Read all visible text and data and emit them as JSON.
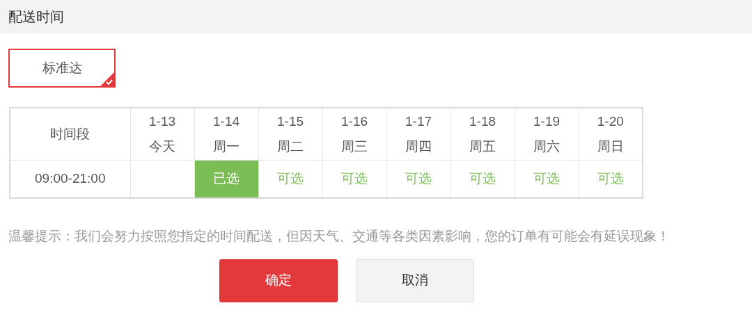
{
  "header": {
    "title": "配送时间"
  },
  "delivery_options": [
    {
      "label": "标准达",
      "selected": true
    }
  ],
  "schedule": {
    "corner_label": "时间段",
    "days": [
      {
        "date": "1-13",
        "weekday": "今天"
      },
      {
        "date": "1-14",
        "weekday": "周一"
      },
      {
        "date": "1-15",
        "weekday": "周二"
      },
      {
        "date": "1-16",
        "weekday": "周三"
      },
      {
        "date": "1-17",
        "weekday": "周四"
      },
      {
        "date": "1-18",
        "weekday": "周五"
      },
      {
        "date": "1-19",
        "weekday": "周六"
      },
      {
        "date": "1-20",
        "weekday": "周日"
      }
    ],
    "rows": [
      {
        "time": "09:00-21:00",
        "cells": [
          {
            "kind": "empty"
          },
          {
            "kind": "option",
            "label": "已选",
            "selected": true
          },
          {
            "kind": "option",
            "label": "可选",
            "selected": false
          },
          {
            "kind": "option",
            "label": "可选",
            "selected": false
          },
          {
            "kind": "option",
            "label": "可选",
            "selected": false
          },
          {
            "kind": "option",
            "label": "可选",
            "selected": false
          },
          {
            "kind": "option",
            "label": "可选",
            "selected": false
          },
          {
            "kind": "option",
            "label": "可选",
            "selected": false
          }
        ]
      }
    ]
  },
  "notice": "温馨提示：我们会努力按照您指定的时间配送，但因天气、交通等各类因素影响，您的订单有可能会有延误现象！",
  "buttons": [
    {
      "label": "确定",
      "kind": "primary"
    },
    {
      "label": "取消",
      "kind": "secondary"
    }
  ]
}
